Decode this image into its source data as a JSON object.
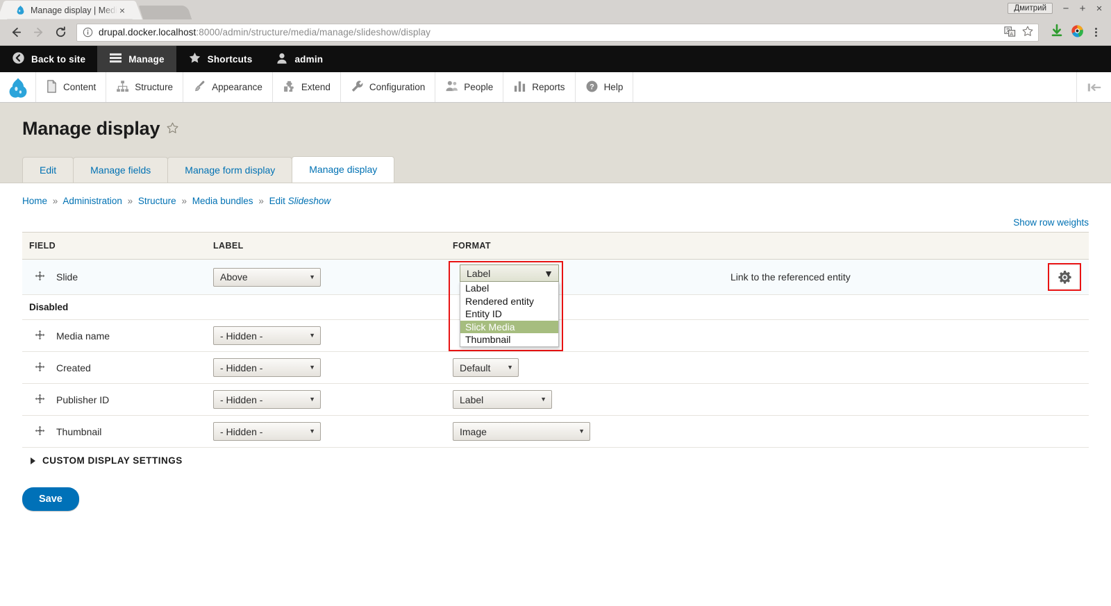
{
  "browser": {
    "tab": {
      "title": "Manage display | Medi",
      "favicon": "drupal-drop-icon",
      "close": "×"
    },
    "window_user": "Дмитрий",
    "window_controls": {
      "minimize": "−",
      "maximize": "+",
      "close": "×"
    },
    "nav": {
      "back": "←",
      "forward": "→",
      "reload": "⟳"
    },
    "url_host": "drupal.docker.localhost",
    "url_rest": ":8000/admin/structure/media/manage/slideshow/display",
    "omnibox_icons": [
      "info-icon",
      "translate-icon",
      "bookmark-star-icon"
    ],
    "toolbar_icons": [
      "download-icon",
      "extension-icon",
      "chrome-menu-icon"
    ]
  },
  "admin_toolbar": {
    "items": [
      {
        "label": "Back to site",
        "icon": "back-arrow-circle-icon",
        "active": false
      },
      {
        "label": "Manage",
        "icon": "hamburger-icon",
        "active": true
      },
      {
        "label": "Shortcuts",
        "icon": "star-icon",
        "active": false
      },
      {
        "label": "admin",
        "icon": "user-icon",
        "active": false
      }
    ]
  },
  "admin_menu": {
    "logo": "drupal-drop-icon",
    "items": [
      {
        "label": "Content",
        "icon": "file-icon"
      },
      {
        "label": "Structure",
        "icon": "structure-icon"
      },
      {
        "label": "Appearance",
        "icon": "paintbrush-icon"
      },
      {
        "label": "Extend",
        "icon": "puzzle-icon"
      },
      {
        "label": "Configuration",
        "icon": "wrench-icon"
      },
      {
        "label": "People",
        "icon": "people-icon"
      },
      {
        "label": "Reports",
        "icon": "bar-chart-icon"
      },
      {
        "label": "Help",
        "icon": "question-circle-icon"
      }
    ],
    "orientation_toggle": "toolbar-orientation-icon"
  },
  "page": {
    "title": "Manage display",
    "title_star": "star-outline-icon",
    "tabs": [
      {
        "label": "Edit",
        "active": false
      },
      {
        "label": "Manage fields",
        "active": false
      },
      {
        "label": "Manage form display",
        "active": false
      },
      {
        "label": "Manage display",
        "active": true
      }
    ],
    "breadcrumb": [
      {
        "label": "Home",
        "italic": false
      },
      {
        "label": "Administration",
        "italic": false
      },
      {
        "label": "Structure",
        "italic": false
      },
      {
        "label": "Media bundles",
        "italic": false
      },
      {
        "label": "Edit ",
        "italic": false,
        "suffix": "Slideshow"
      }
    ],
    "breadcrumb_separator": "»",
    "breadcrumb_last_prefix": "Edit",
    "breadcrumb_last_italic": "Slideshow",
    "show_row_weights": "Show row weights"
  },
  "table": {
    "headers": {
      "field": "FIELD",
      "label": "LABEL",
      "format": "FORMAT"
    },
    "rows": [
      {
        "field": "Slide",
        "drag": "drag-handle-icon",
        "label_value": "Above",
        "format_value": "Label",
        "summary": "Link to the referenced entity",
        "settings_icon": "gear-icon",
        "enabled": true
      }
    ],
    "region_disabled": "Disabled",
    "disabled_rows": [
      {
        "field": "Media name",
        "drag": "drag-handle-icon",
        "label_value": "- Hidden -",
        "format_value": ""
      },
      {
        "field": "Created",
        "drag": "drag-handle-icon",
        "label_value": "- Hidden -",
        "format_value": "Default"
      },
      {
        "field": "Publisher ID",
        "drag": "drag-handle-icon",
        "label_value": "- Hidden -",
        "format_value": "Label"
      },
      {
        "field": "Thumbnail",
        "drag": "drag-handle-icon",
        "label_value": "- Hidden -",
        "format_value": "Image"
      }
    ]
  },
  "open_dropdown": {
    "current": "Label",
    "options": [
      {
        "label": "Label",
        "highlighted": false
      },
      {
        "label": "Rendered entity",
        "highlighted": false
      },
      {
        "label": "Entity ID",
        "highlighted": false
      },
      {
        "label": "Slick Media",
        "highlighted": true
      },
      {
        "label": "Thumbnail",
        "highlighted": false
      }
    ],
    "highlight_color": "#a6bd7f",
    "annotation_color": "#e81313"
  },
  "custom_display_settings": {
    "label": "CUSTOM DISPLAY SETTINGS",
    "expanded": false
  },
  "save_button": "Save"
}
